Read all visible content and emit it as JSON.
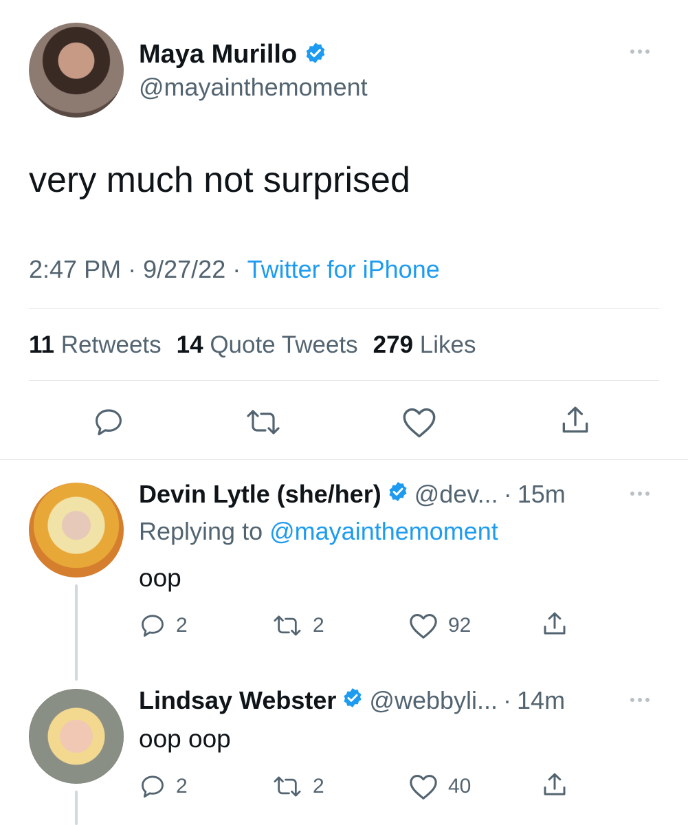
{
  "main_tweet": {
    "author_name": "Maya Murillo",
    "author_handle": "@mayainthemoment",
    "text": "very much not surprised",
    "time": "2:47 PM",
    "date": "9/27/22",
    "separator": "·",
    "source": "Twitter for iPhone",
    "stats": {
      "retweets_count": "11",
      "retweets_label": "Retweets",
      "quotes_count": "14",
      "quotes_label": "Quote Tweets",
      "likes_count": "279",
      "likes_label": "Likes"
    }
  },
  "replies": [
    {
      "author_name": "Devin Lytle (she/her)",
      "author_handle": "@dev...",
      "time": "15m",
      "separator": "·",
      "replying_prefix": "Replying to",
      "replying_to": "@mayainthemoment",
      "text": "oop",
      "reply_count": "2",
      "retweet_count": "2",
      "like_count": "92"
    },
    {
      "author_name": "Lindsay Webster",
      "author_handle": "@webbyli...",
      "time": "14m",
      "separator": "·",
      "text": "oop oop",
      "reply_count": "2",
      "retweet_count": "2",
      "like_count": "40"
    }
  ],
  "colors": {
    "accent": "#1d9bf0",
    "text": "#0f1419",
    "muted": "#536471"
  },
  "icons": [
    "verified-badge-icon",
    "more-icon",
    "reply-icon",
    "retweet-icon",
    "like-icon",
    "share-icon"
  ]
}
